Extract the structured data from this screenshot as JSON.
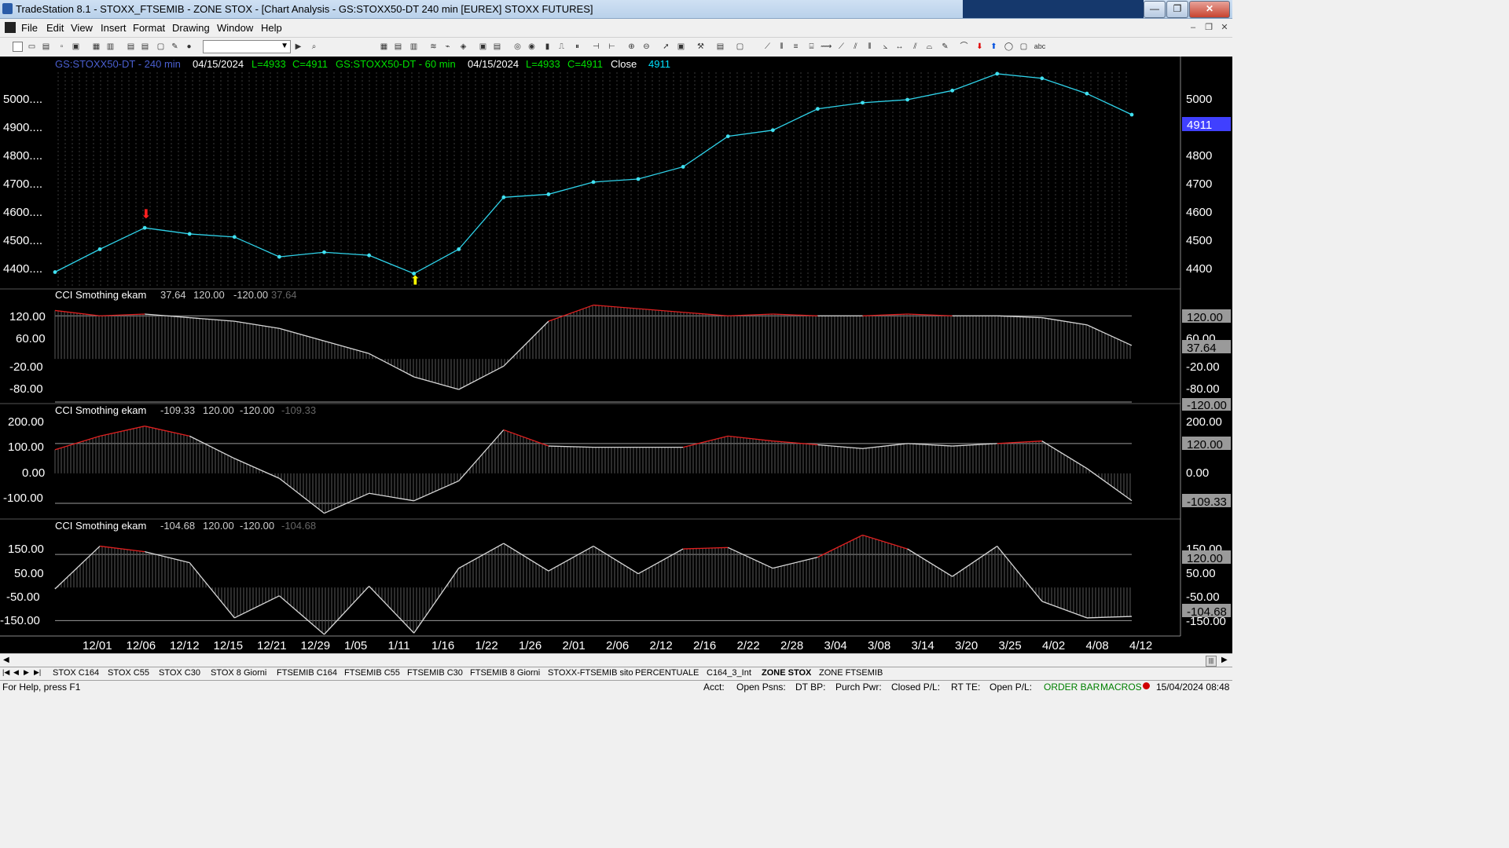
{
  "window": {
    "title": "TradeStation 8.1 - STOXX_FTSEMIB - ZONE STOX - [Chart Analysis - GS:STOXX50-DT  240 min  [EUREX] STOXX FUTURES]",
    "minimize": "—",
    "maximize": "❐",
    "close": "✕"
  },
  "menu": {
    "items": [
      "File",
      "Edit",
      "View",
      "Insert",
      "Format",
      "Drawing",
      "Window",
      "Help"
    ]
  },
  "toolbar": {
    "combo_value": ""
  },
  "chart_header": [
    {
      "text": "GS:STOXX50-DT - 240 min",
      "color": "#4a5fd0"
    },
    {
      "text": "04/15/2024",
      "color": "#ffffff"
    },
    {
      "text": "L=4933",
      "color": "#00e000"
    },
    {
      "text": "C=4911",
      "color": "#00e000"
    },
    {
      "text": "GS:STOXX50-DT - 60 min",
      "color": "#00e000"
    },
    {
      "text": "04/15/2024",
      "color": "#ffffff"
    },
    {
      "text": "L=4933",
      "color": "#00e000"
    },
    {
      "text": "C=4911",
      "color": "#00e000"
    },
    {
      "text": "Close",
      "color": "#ffffff"
    },
    {
      "text": "4911",
      "color": "#00e0ff"
    }
  ],
  "x_axis": {
    "labels": [
      "12/01",
      "12/06",
      "12/12",
      "12/15",
      "12/21",
      "12/29",
      "1/05",
      "1/11",
      "1/16",
      "1/22",
      "1/26",
      "2/01",
      "2/06",
      "2/12",
      "2/16",
      "2/22",
      "2/28",
      "3/04",
      "3/08",
      "3/14",
      "3/20",
      "3/25",
      "4/02",
      "4/08",
      "4/12"
    ]
  },
  "price_panel": {
    "left_ticks": [
      "5000....",
      "4900....",
      "4800....",
      "4700....",
      "4600....",
      "4500....",
      "4400...."
    ],
    "right_ticks": [
      "5000",
      "4900",
      "4800",
      "4700",
      "4600",
      "4500",
      "4400"
    ],
    "last_value": "4911",
    "last_value_color": "#4040ff"
  },
  "cci_panels": [
    {
      "name": "CCI Smothing ekam",
      "v1": "37.64",
      "v2": "120.00",
      "v3": "-120.00",
      "v4": "37.64",
      "left_ticks": [
        "120.00",
        "60.00",
        "-20.00",
        "-80.00"
      ],
      "right_labels": [
        "120.00",
        "60.00",
        "37.64",
        "-20.00",
        "-80.00",
        "-120.00"
      ]
    },
    {
      "name": "CCI Smothing ekam",
      "v1": "-109.33",
      "v2": "120.00",
      "v3": "-120.00",
      "v4": "-109.33",
      "left_ticks": [
        "200.00",
        "100.00",
        "0.00",
        "-100.00"
      ],
      "right_labels": [
        "200.00",
        "120.00",
        "0.00",
        "-109.33"
      ]
    },
    {
      "name": "CCI Smothing ekam",
      "v1": "-104.68",
      "v2": "120.00",
      "v3": "-120.00",
      "v4": "-104.68",
      "left_ticks": [
        "150.00",
        "50.00",
        "-50.00",
        "-150.00"
      ],
      "right_labels": [
        "150.00",
        "120.00",
        "50.00",
        "-50.00",
        "-104.68",
        "-150.00"
      ]
    }
  ],
  "chart_data": [
    {
      "type": "line",
      "title": "GS:STOXX50-DT - 240 min",
      "x": [
        "12/01",
        "12/06",
        "12/12",
        "12/15",
        "12/21",
        "12/29",
        "1/05",
        "1/11",
        "1/16",
        "1/22",
        "1/26",
        "2/01",
        "2/06",
        "2/12",
        "2/16",
        "2/22",
        "2/28",
        "3/04",
        "3/08",
        "3/14",
        "3/20",
        "3/25",
        "4/02",
        "4/08",
        "4/12"
      ],
      "series": [
        {
          "name": "GS:STOXX50-DT - 240 min",
          "values": [
            4395,
            4470,
            4540,
            4520,
            4510,
            4445,
            4460,
            4450,
            4390,
            4470,
            4640,
            4650,
            4690,
            4700,
            4740,
            4840,
            4860,
            4930,
            4950,
            4960,
            4990,
            5045,
            5030,
            4980,
            4911
          ]
        }
      ],
      "ylim": [
        4350,
        5050
      ],
      "annotations": [
        {
          "x": "12/12",
          "text": "down arrow",
          "color": "#ff2020"
        },
        {
          "x": "1/16",
          "text": "up arrow",
          "color": "#ffff00"
        }
      ]
    },
    {
      "type": "line",
      "title": "CCI Smothing ekam",
      "x": [
        "12/01",
        "12/06",
        "12/12",
        "12/15",
        "12/21",
        "12/29",
        "1/05",
        "1/11",
        "1/16",
        "1/22",
        "1/26",
        "2/01",
        "2/06",
        "2/12",
        "2/16",
        "2/22",
        "2/28",
        "3/04",
        "3/08",
        "3/14",
        "3/20",
        "3/25",
        "4/02",
        "4/08",
        "4/12"
      ],
      "series": [
        {
          "name": "CCI Smothing ekam",
          "values": [
            135,
            120,
            125,
            115,
            105,
            85,
            50,
            15,
            -50,
            -85,
            -20,
            105,
            150,
            140,
            130,
            120,
            125,
            120,
            120,
            125,
            120,
            120,
            115,
            95,
            37.64
          ]
        }
      ],
      "ylim": [
        -120,
        160
      ]
    },
    {
      "type": "line",
      "title": "CCI Smothing ekam",
      "x": [
        "12/01",
        "12/06",
        "12/12",
        "12/15",
        "12/21",
        "12/29",
        "1/05",
        "1/11",
        "1/16",
        "1/22",
        "1/26",
        "2/01",
        "2/06",
        "2/12",
        "2/16",
        "2/22",
        "2/28",
        "3/04",
        "3/08",
        "3/14",
        "3/20",
        "3/25",
        "4/02",
        "4/08",
        "4/12"
      ],
      "series": [
        {
          "name": "CCI Smothing ekam",
          "values": [
            95,
            150,
            190,
            150,
            60,
            -20,
            -160,
            -80,
            -110,
            -30,
            175,
            110,
            105,
            105,
            105,
            150,
            130,
            115,
            100,
            120,
            110,
            120,
            130,
            20,
            -109.33
          ]
        }
      ],
      "ylim": [
        -180,
        230
      ]
    },
    {
      "type": "line",
      "title": "CCI Smothing ekam",
      "x": [
        "12/01",
        "12/06",
        "12/12",
        "12/15",
        "12/21",
        "12/29",
        "1/05",
        "1/11",
        "1/16",
        "1/22",
        "1/26",
        "2/01",
        "2/06",
        "2/12",
        "2/16",
        "2/22",
        "2/28",
        "3/04",
        "3/08",
        "3/14",
        "3/20",
        "3/25",
        "4/02",
        "4/08",
        "4/12"
      ],
      "series": [
        {
          "name": "CCI Smothing ekam",
          "values": [
            -5,
            150,
            130,
            90,
            -110,
            -30,
            -170,
            5,
            -165,
            70,
            160,
            60,
            150,
            50,
            140,
            145,
            70,
            110,
            190,
            140,
            40,
            150,
            -50,
            -110,
            -104.68
          ]
        }
      ],
      "ylim": [
        -170,
        200
      ]
    }
  ],
  "sheet_tabs": [
    "STOX C164",
    "STOX C55",
    "STOX  C30",
    "STOX  8 Giorni",
    "FTSEMIB C164",
    "FTSEMIB C55",
    "FTSEMIB C30",
    "FTSEMIB  8 Giorni",
    "STOXX-FTSEMIB sito",
    "PERCENTUALE",
    "C164_3_Int",
    "ZONE STOX",
    "ZONE FTSEMIB"
  ],
  "active_tab": "ZONE STOX",
  "status": {
    "help": "For Help, press F1",
    "acct": "Acct:",
    "open_psns": "Open Psns:",
    "dt_bp": "DT BP:",
    "purch_pwr": "Purch Pwr:",
    "closed_pl": "Closed P/L:",
    "rt_te": "RT TE:",
    "open_pl": "Open P/L:",
    "order_bar": "ORDER BAR",
    "macros": "MACROS",
    "datetime": "15/04/2024 08:48"
  }
}
